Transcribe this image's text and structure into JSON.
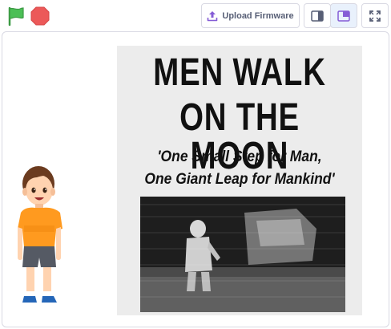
{
  "toolbar": {
    "upload_label": "Upload Firmware"
  },
  "stage": {
    "newspaper": {
      "headline_line1": "MEN WALK",
      "headline_line2": "ON THE MOON",
      "subhead_line1": "'One Small Step for Man,",
      "subhead_line2": "One Giant Leap for Mankind'"
    }
  },
  "colors": {
    "flag_green": "#4cbf56",
    "stop_red": "#ec5959",
    "button_text": "#575e75",
    "accent_purple": "#855cd6"
  },
  "icons": [
    "green-flag-icon",
    "stop-icon",
    "upload-icon",
    "small-stage-icon",
    "large-stage-icon",
    "fullscreen-icon"
  ]
}
